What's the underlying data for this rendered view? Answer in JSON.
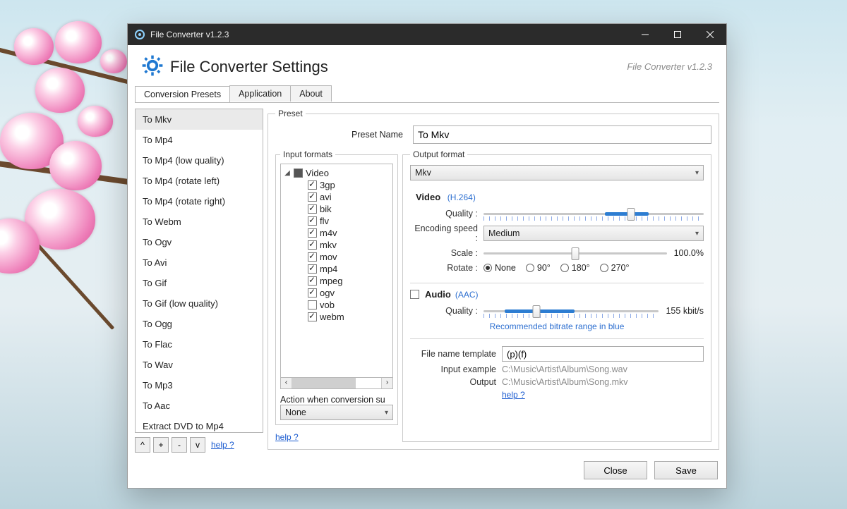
{
  "window": {
    "title": "File Converter v1.2.3"
  },
  "header": {
    "title": "File Converter Settings",
    "version": "File Converter v1.2.3"
  },
  "tabs": [
    "Conversion Presets",
    "Application",
    "About"
  ],
  "preset_list": {
    "selected": 0,
    "items": [
      "To Mkv",
      "To Mp4",
      "To Mp4 (low quality)",
      "To Mp4 (rotate left)",
      "To Mp4 (rotate right)",
      "To Webm",
      "To Ogv",
      "To Avi",
      "To Gif",
      "To Gif (low quality)",
      "To Ogg",
      "To Flac",
      "To Wav",
      "To Mp3",
      "To Aac",
      "Extract DVD to Mp4"
    ],
    "buttons": {
      "up": "^",
      "add": "+",
      "remove": "-",
      "down": "v"
    },
    "help": "help ?"
  },
  "preset": {
    "legend": "Preset",
    "name_label": "Preset Name",
    "name_value": "To Mkv"
  },
  "input_formats": {
    "legend": "Input formats",
    "group": "Video",
    "items": [
      {
        "label": "3gp",
        "checked": true
      },
      {
        "label": "avi",
        "checked": true
      },
      {
        "label": "bik",
        "checked": true
      },
      {
        "label": "flv",
        "checked": true
      },
      {
        "label": "m4v",
        "checked": true
      },
      {
        "label": "mkv",
        "checked": true
      },
      {
        "label": "mov",
        "checked": true
      },
      {
        "label": "mp4",
        "checked": true
      },
      {
        "label": "mpeg",
        "checked": true
      },
      {
        "label": "ogv",
        "checked": true
      },
      {
        "label": "vob",
        "checked": false
      },
      {
        "label": "webm",
        "checked": true
      }
    ],
    "action_label": "Action when conversion su",
    "action_value": "None",
    "help": "help ?"
  },
  "output": {
    "legend": "Output format",
    "format": "Mkv",
    "video": {
      "heading": "Video",
      "codec": "(H.264)",
      "quality_label": "Quality :",
      "encoding_label": "Encoding speed :",
      "encoding_value": "Medium",
      "scale_label": "Scale :",
      "scale_value": "100.0%",
      "rotate_label": "Rotate :",
      "rotate_options": [
        "None",
        "90°",
        "180°",
        "270°"
      ],
      "rotate_selected": "None"
    },
    "audio": {
      "heading": "Audio",
      "codec": "(AAC)",
      "enabled": true,
      "quality_label": "Quality :",
      "quality_value": "155 kbit/s",
      "hint": "Recommended bitrate range in blue"
    },
    "template_label": "File name template",
    "template_value": "(p)(f)",
    "example_in_label": "Input example",
    "example_in": "C:\\Music\\Artist\\Album\\Song.wav",
    "example_out_label": "Output",
    "example_out": "C:\\Music\\Artist\\Album\\Song.mkv",
    "help": "help ?"
  },
  "footer": {
    "close": "Close",
    "save": "Save"
  }
}
